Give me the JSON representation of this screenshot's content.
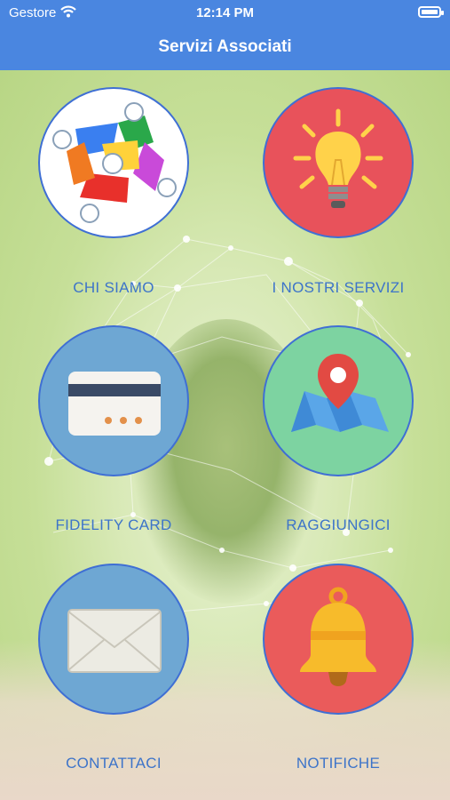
{
  "status_bar": {
    "carrier": "Gestore",
    "time": "12:14 PM"
  },
  "nav": {
    "title": "Servizi Associati"
  },
  "menu": [
    {
      "label": "CHI SIAMO",
      "icon": "colorful-logo-icon",
      "color": "#ffffff"
    },
    {
      "label": "I NOSTRI SERVIZI",
      "icon": "lightbulb-icon",
      "color": "#e8525b"
    },
    {
      "label": "FIDELITY CARD",
      "icon": "credit-card-icon",
      "color": "#6ea7d3"
    },
    {
      "label": "RAGGIUNGICI",
      "icon": "map-pin-icon",
      "color": "#7dd3a1"
    },
    {
      "label": "CONTATTACI",
      "icon": "envelope-icon",
      "color": "#6ea7d3"
    },
    {
      "label": "NOTIFICHE",
      "icon": "bell-icon",
      "color": "#ea5b5b"
    }
  ],
  "colors": {
    "nav_bg": "#4a86e0",
    "label": "#3d74c9",
    "circle_border": "#3f6fd4"
  }
}
